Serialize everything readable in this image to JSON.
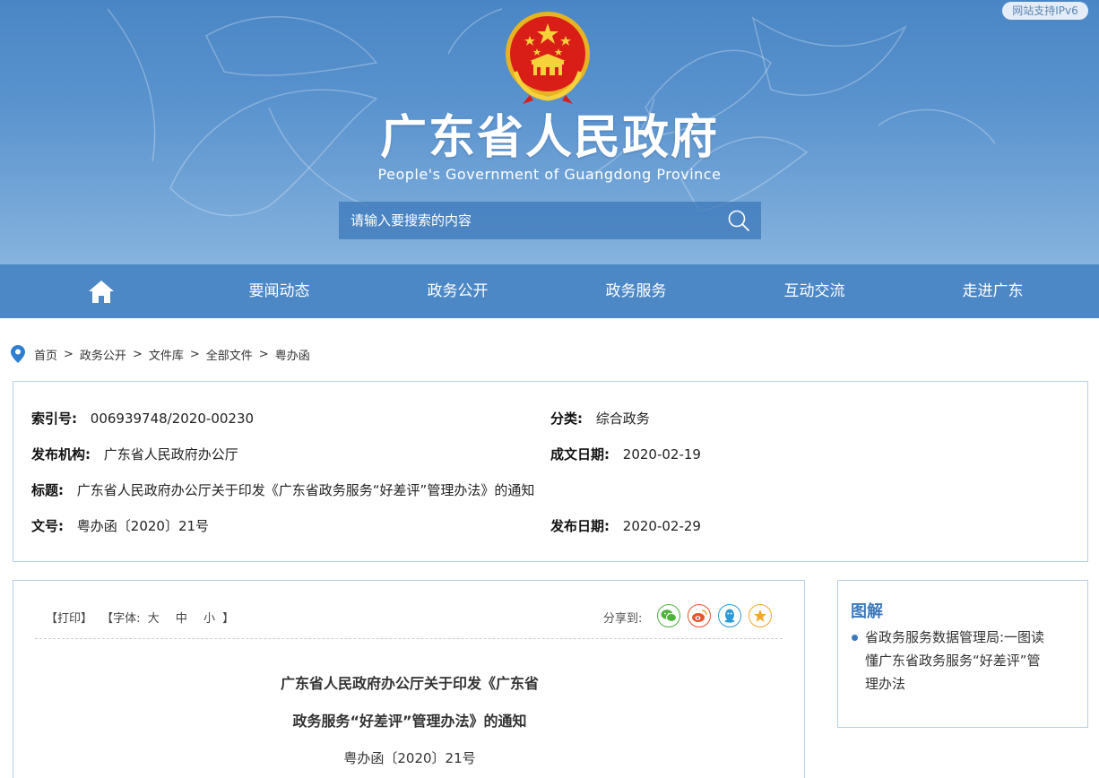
{
  "header": {
    "ipv6_badge": "网站支持IPv6",
    "title": "广东省人民政府",
    "subtitle": "People's Government of Guangdong Province",
    "search_placeholder": "请输入要搜索的内容"
  },
  "nav": {
    "items": [
      "要闻动态",
      "政务公开",
      "政务服务",
      "互动交流",
      "走进广东"
    ]
  },
  "breadcrumb": {
    "items": [
      "首页",
      "政务公开",
      "文件库",
      "全部文件",
      "粤办函"
    ],
    "separator": ">"
  },
  "info": {
    "index_label": "索引号:",
    "index_value": "006939748/2020-00230",
    "category_label": "分类:",
    "category_value": "综合政务",
    "publisher_label": "发布机构:",
    "publisher_value": "广东省人民政府办公厅",
    "written_date_label": "成文日期:",
    "written_date_value": "2020-02-19",
    "title_label": "标题:",
    "title_value": "广东省人民政府办公厅关于印发《广东省政务服务“好差评”管理办法》的通知",
    "doc_no_label": "文号:",
    "doc_no_value": "粤办函〔2020〕21号",
    "publish_date_label": "发布日期:",
    "publish_date_value": "2020-02-29"
  },
  "article": {
    "print": "【打印】",
    "font_prefix": "【字体:",
    "font_large": "大",
    "font_medium": "中",
    "font_small": "小",
    "font_suffix": "】",
    "share_label": "分享到:",
    "share_icons": [
      "wechat-icon",
      "weibo-icon",
      "qq-icon",
      "qzone-icon"
    ],
    "title_line1": "广东省人民政府办公厅关于印发《广东省",
    "title_line2": "政务服务“好差评”管理办法》的通知",
    "doc_no": "粤办函〔2020〕21号"
  },
  "side": {
    "title": "图解",
    "item_line1": "省政务服务数据管理局:一图读",
    "item_line2": "懂广东省政务服务“好差评”管",
    "item_line3": "理办法"
  },
  "colors": {
    "nav_bg": "#4d88c6",
    "accent": "#3a79bd",
    "border": "#b7cfe8",
    "wechat": "#4cb43a",
    "weibo": "#e6532c",
    "qq": "#2a9ad9",
    "qzone": "#f3a72a"
  }
}
